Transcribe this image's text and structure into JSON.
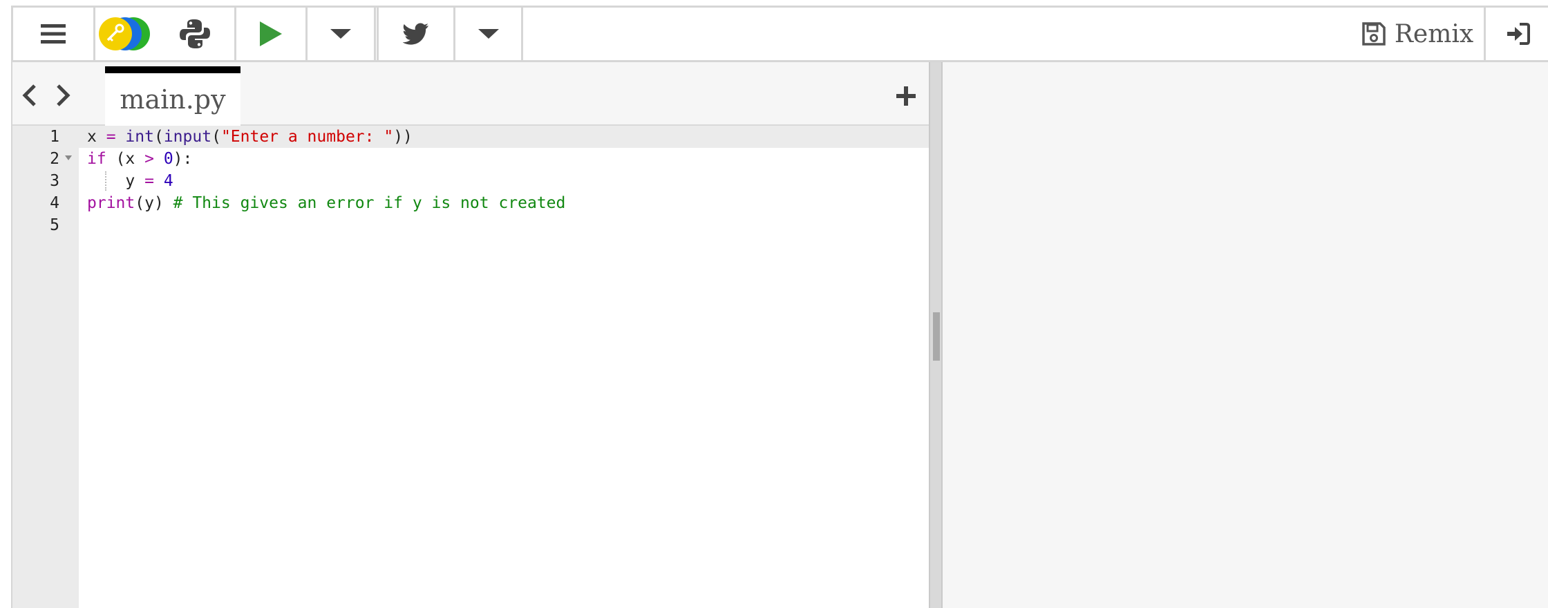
{
  "toolbar": {
    "remix_label": "Remix"
  },
  "editor": {
    "tab_label": "main.py",
    "line_numbers": [
      "1",
      "2",
      "3",
      "4",
      "5"
    ],
    "code": {
      "l1": {
        "a": "x ",
        "b": "=",
        "c": " ",
        "d": "int",
        "e": "(",
        "f": "input",
        "g": "(",
        "h": "\"Enter a number: \"",
        "i": "))"
      },
      "l2": {
        "a": "if",
        "b": " (x ",
        "c": ">",
        "d": " ",
        "e": "0",
        "f": "):"
      },
      "l3": {
        "a": "    y ",
        "b": "=",
        "c": " ",
        "d": "4"
      },
      "l4": {
        "a": "print",
        "b": "(y) ",
        "c": "# This gives an error if y is not created"
      }
    }
  },
  "colors": {
    "keyword": "#a3119f",
    "string": "#d00000",
    "number": "#2d00b8",
    "comment": "#118811",
    "run": "#3a9a3a"
  },
  "icons": [
    "menu-icon",
    "key-logo-icon",
    "python-icon",
    "run-icon",
    "chevron-down-icon",
    "twitter-icon",
    "save-icon",
    "login-icon",
    "prev-icon",
    "next-icon",
    "plus-icon"
  ]
}
